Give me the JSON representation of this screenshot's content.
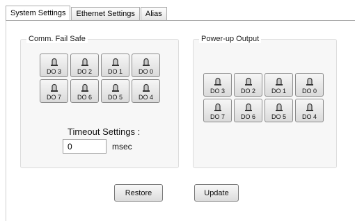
{
  "tabs": [
    {
      "label": "System Settings",
      "active": true
    },
    {
      "label": "Ethernet Settings",
      "active": false
    },
    {
      "label": "Alias",
      "active": false
    }
  ],
  "comm_fail_safe": {
    "title": "Comm. Fail Safe",
    "buttons": [
      "DO 3",
      "DO 2",
      "DO 1",
      "DO 0",
      "DO 7",
      "DO 6",
      "DO 5",
      "DO 4"
    ],
    "timeout_label": "Timeout Settings :",
    "timeout_value": "0",
    "unit": "msec"
  },
  "power_up_output": {
    "title": "Power-up Output",
    "buttons": [
      "DO 3",
      "DO 2",
      "DO 1",
      "DO 0",
      "DO 7",
      "DO 6",
      "DO 5",
      "DO 4"
    ]
  },
  "actions": {
    "restore_label": "Restore",
    "update_label": "Update"
  },
  "icons": {
    "do_button": "bell-icon"
  }
}
